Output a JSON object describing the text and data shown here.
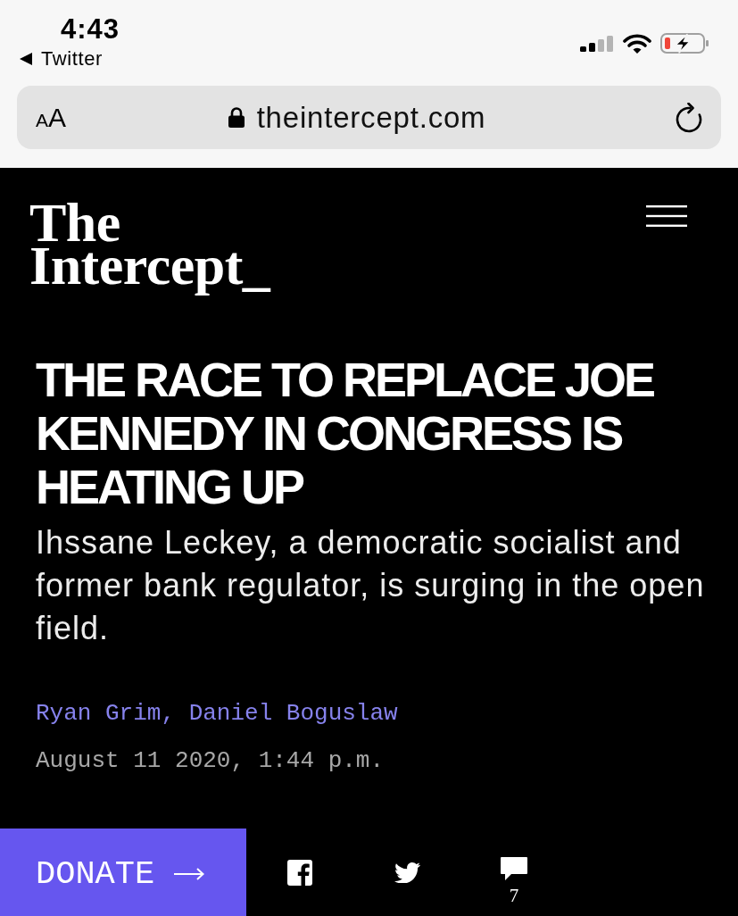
{
  "status_bar": {
    "time": "4:43",
    "back_label": "Twitter"
  },
  "browser": {
    "text_size_letters": [
      "A",
      "A"
    ],
    "url": "theintercept.com"
  },
  "header": {
    "logo_lines": [
      "The",
      "Intercept_"
    ]
  },
  "article": {
    "headline": "THE RACE TO REPLACE JOE KENNEDY IN CONGRESS IS HEATING UP",
    "subtitle": "Ihssane Leckey, a democratic socialist and former bank regulator, is surging in the open field.",
    "byline": "Ryan Grim, Daniel Boguslaw",
    "date": "August 11 2020, 1:44 p.m."
  },
  "action_bar": {
    "donate_label": "DONATE",
    "comment_count": "7"
  }
}
